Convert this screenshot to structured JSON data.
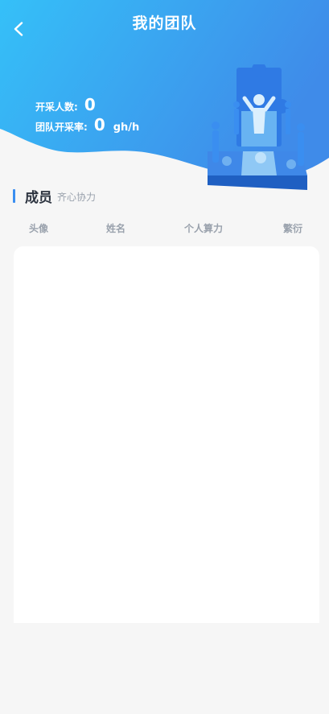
{
  "header": {
    "title": "我的团队",
    "back_icon": "chevron-left-icon"
  },
  "stats": {
    "miners_label": "开采人数:",
    "miners_value": "0",
    "rate_label": "团队开采率:",
    "rate_value": "0",
    "rate_unit": "gh/h"
  },
  "section": {
    "title": "成员",
    "subtitle": "齐心协力"
  },
  "table": {
    "columns": [
      "头像",
      "姓名",
      "个人算力",
      "繁衍"
    ],
    "rows": []
  },
  "colors": {
    "gradient_start": "#35c0f8",
    "gradient_end": "#3f8be9",
    "accent": "#3a8ef0",
    "page_bg": "#f6f6f6"
  }
}
